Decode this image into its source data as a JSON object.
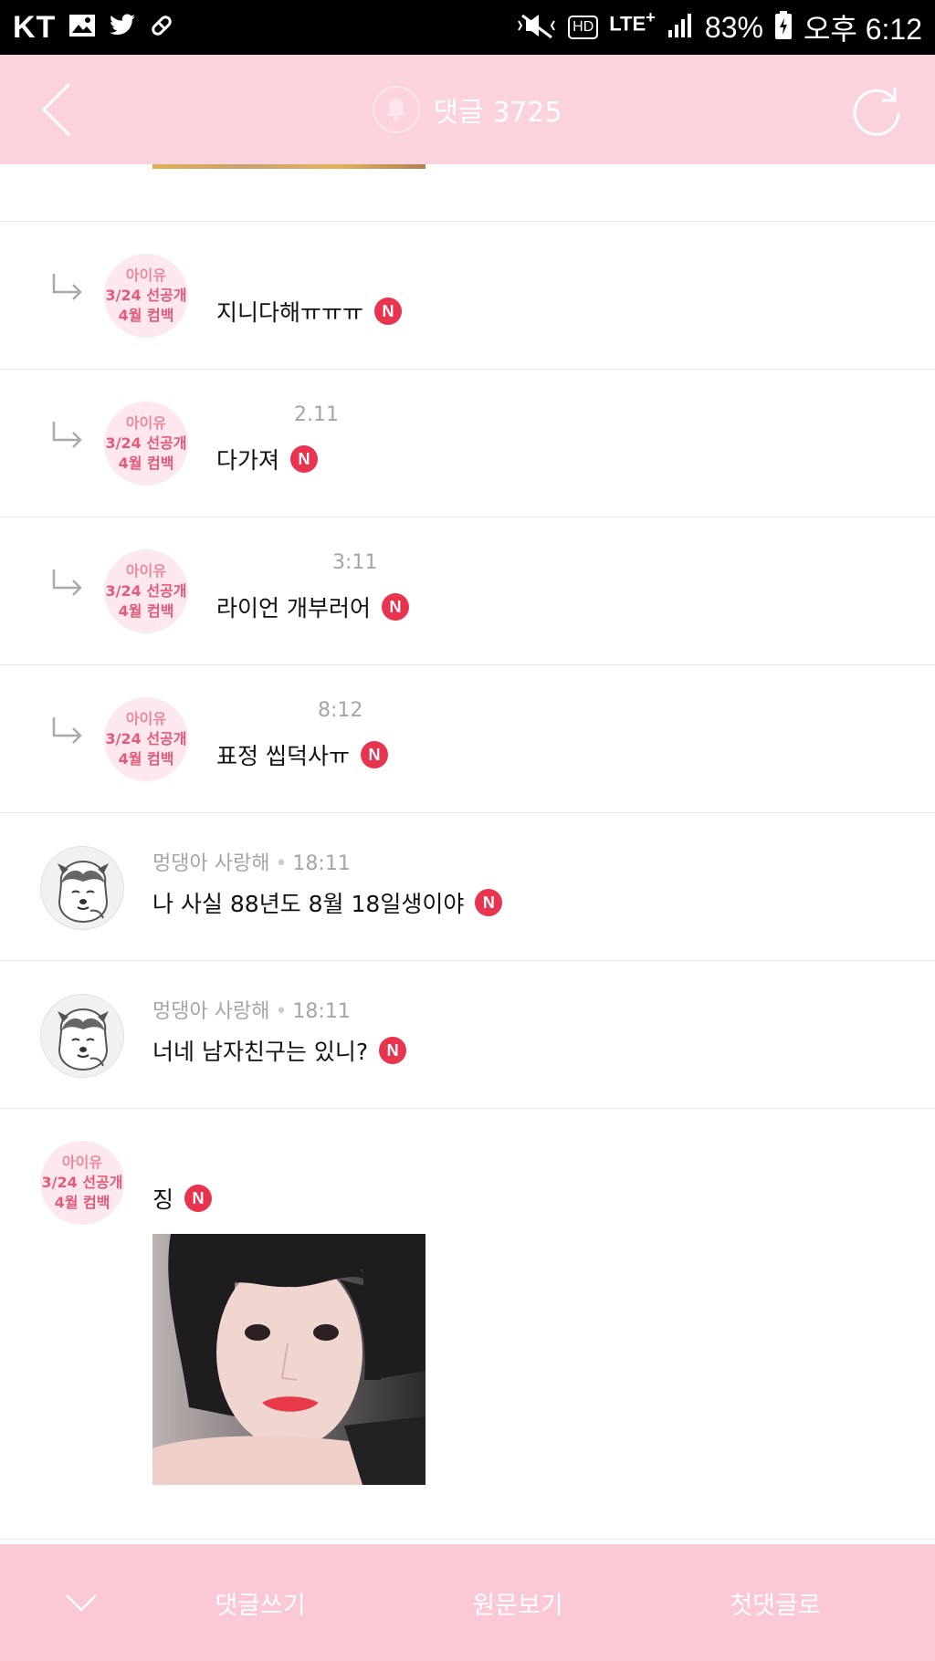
{
  "status_bar": {
    "carrier": "KT",
    "battery": "83%",
    "time": "오후 6:12",
    "network": "LTE",
    "hd": "HD",
    "icons": [
      "image-icon",
      "twitter-icon",
      "pill-icon",
      "mute-icon",
      "hd-icon",
      "lte-icon",
      "signal-icon",
      "battery-icon"
    ]
  },
  "header": {
    "title": "댓글 3725",
    "icons": [
      "back-icon",
      "bell-icon",
      "refresh-icon"
    ]
  },
  "comments": [
    {
      "type": "reply",
      "meta_visible": "",
      "text": "지니다해ㅠㅠㅠ",
      "badge": "N"
    },
    {
      "type": "reply",
      "meta_visible": "2.11",
      "text": "다가져",
      "badge": "N"
    },
    {
      "type": "reply",
      "meta_visible": "3:11",
      "text": "라이언 개부러어",
      "badge": "N"
    },
    {
      "type": "reply",
      "meta_visible": "8:12",
      "text": "표정 씹덕사ㅠ",
      "badge": "N"
    },
    {
      "type": "comment",
      "author": "멍댕아 사랑해",
      "time": "18:11",
      "text": "나 사실 88년도 8월 18일생이야",
      "badge": "N"
    },
    {
      "type": "comment",
      "author": "멍댕아 사랑해",
      "time": "18:11",
      "text": "너네 남자친구는 있니?",
      "badge": "N"
    },
    {
      "type": "comment",
      "author": "",
      "time": "",
      "text": "징",
      "badge": "N",
      "has_image": true
    }
  ],
  "avatar_badge": {
    "line1": "아이유",
    "line2": "3/24 선공개",
    "line3": "4월 컴백"
  },
  "bottom_bar": {
    "items": [
      "댓글쓰기",
      "원문보기",
      "첫댓글로"
    ],
    "icons": [
      "chevron-down-icon"
    ]
  },
  "colors": {
    "header_bg": "#fad3dc",
    "bottom_bg": "#fbc8d6",
    "badge_red": "#e8344e"
  }
}
